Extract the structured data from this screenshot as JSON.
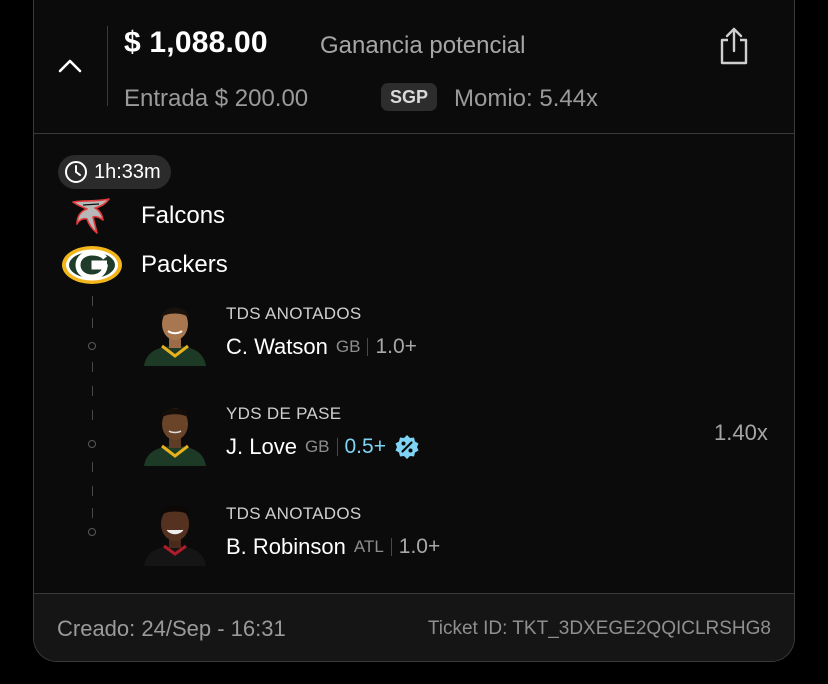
{
  "header": {
    "amount": "$ 1,088.00",
    "amount_label": "Ganancia potencial",
    "entry": "Entrada $ 200.00",
    "badge": "SGP",
    "odds": "Momio: 5.44x"
  },
  "timer": {
    "label": "1h:33m"
  },
  "teams": [
    {
      "name": "Falcons",
      "logo": "falcons-logo-icon"
    },
    {
      "name": "Packers",
      "logo": "packers-logo-icon"
    }
  ],
  "legs": [
    {
      "market": "TDS ANOTADOS",
      "player": "C. Watson",
      "team": "GB",
      "value": "1.0+",
      "boosted": false
    },
    {
      "market": "YDS DE PASE",
      "player": "J. Love",
      "team": "GB",
      "value": "0.5+",
      "boosted": true
    },
    {
      "market": "TDS ANOTADOS",
      "player": "B. Robinson",
      "team": "ATL",
      "value": "1.0+",
      "boosted": false
    }
  ],
  "leg_multiplier": "1.40x",
  "footer": {
    "created": "Creado: 24/Sep - 16:31",
    "ticket_id": "Ticket ID: TKT_3DXEGE2QQICLRSHG8"
  },
  "colors": {
    "boost": "#7fd4f5",
    "background": "#000000",
    "card": "#0b0b0b"
  },
  "icons": [
    "chevron-up-icon",
    "share-icon",
    "clock-icon",
    "boost-percent-icon"
  ]
}
